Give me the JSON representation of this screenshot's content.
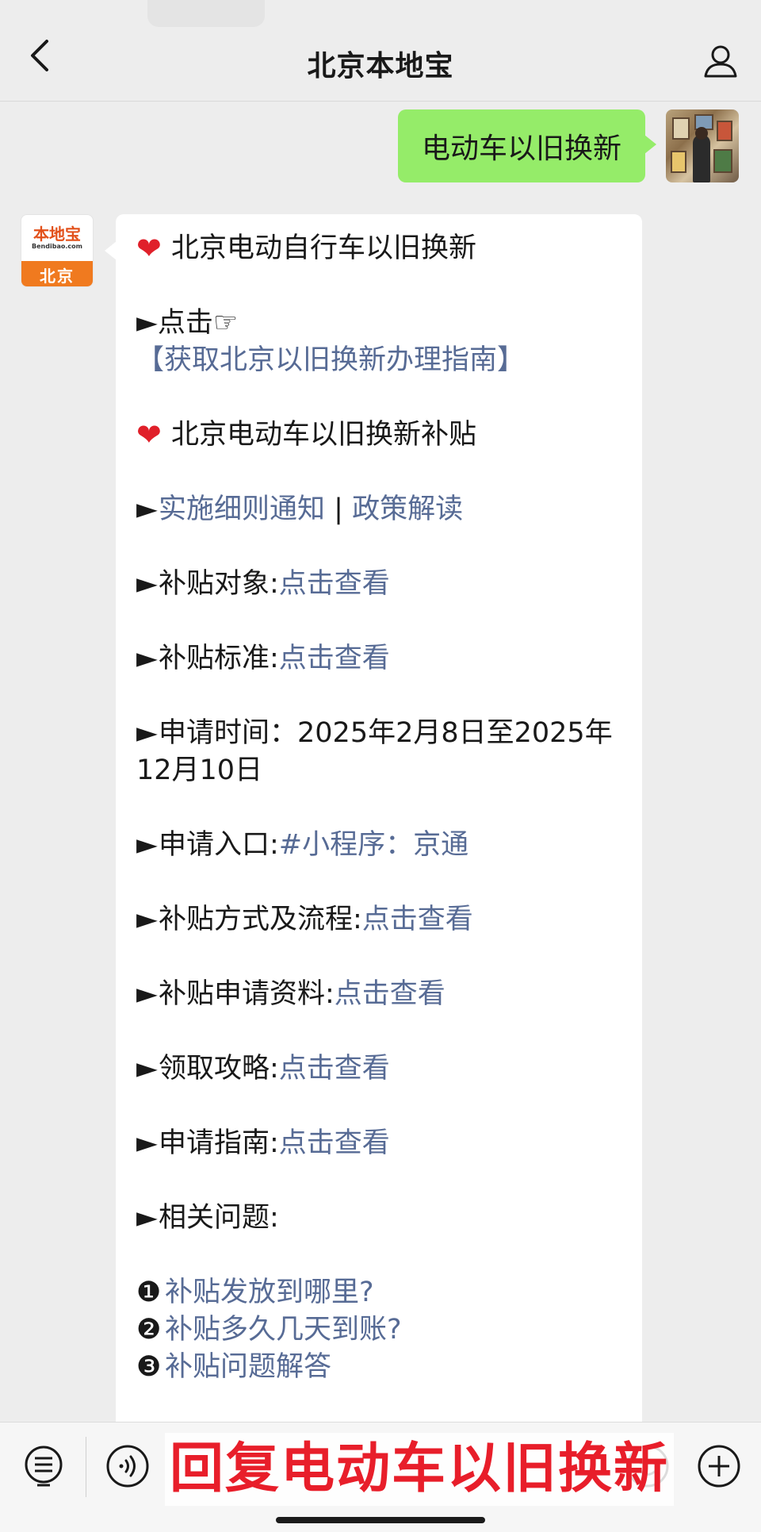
{
  "header": {
    "title": "北京本地宝"
  },
  "outgoing": {
    "text": "电动车以旧换新"
  },
  "brand_avatar": {
    "name": "本地宝",
    "url": "Bendibao.com",
    "city": "北京"
  },
  "message": {
    "heading1": "北京电动自行车以旧换新",
    "row1_prefix": "►点击☞",
    "row1_link": "【获取北京以旧换新办理指南】",
    "heading2": "北京电动车以旧换新补贴",
    "row2_link_a": "实施细则通知",
    "row2_sep": " | ",
    "row2_link_b": "政策解读",
    "row3_label": "补贴对象:",
    "row3_link": "点击查看",
    "row4_label": "补贴标准:",
    "row4_link": "点击查看",
    "row5_label": "申请时间：",
    "row5_value": "2025年2月8日至2025年12月10日",
    "row6_label": "申请入口:",
    "row6_link": "#小程序：京通",
    "row7_label": "补贴方式及流程:",
    "row7_link": "点击查看",
    "row8_label": "补贴申请资料:",
    "row8_link": "点击查看",
    "row9_label": "领取攻略:",
    "row9_link": "点击查看",
    "row10_label": "申请指南:",
    "row10_link": "点击查看",
    "row11_label": "相关问题:",
    "faq": [
      {
        "num": "❶",
        "text": "补贴发放到哪里?"
      },
      {
        "num": "❷",
        "text": "补贴多久几天到账?"
      },
      {
        "num": "❸",
        "text": "补贴问题解答"
      }
    ]
  },
  "overlay_caption": "回复电动车以旧换新",
  "colors": {
    "link": "#576b95",
    "bubble_out": "#95ec69",
    "caption": "#e81e2a",
    "heart": "#e0202a"
  },
  "icons": [
    "back-icon",
    "profile-icon",
    "menu-icon",
    "voice-icon",
    "emoji-icon",
    "plus-icon",
    "heart-icon"
  ]
}
